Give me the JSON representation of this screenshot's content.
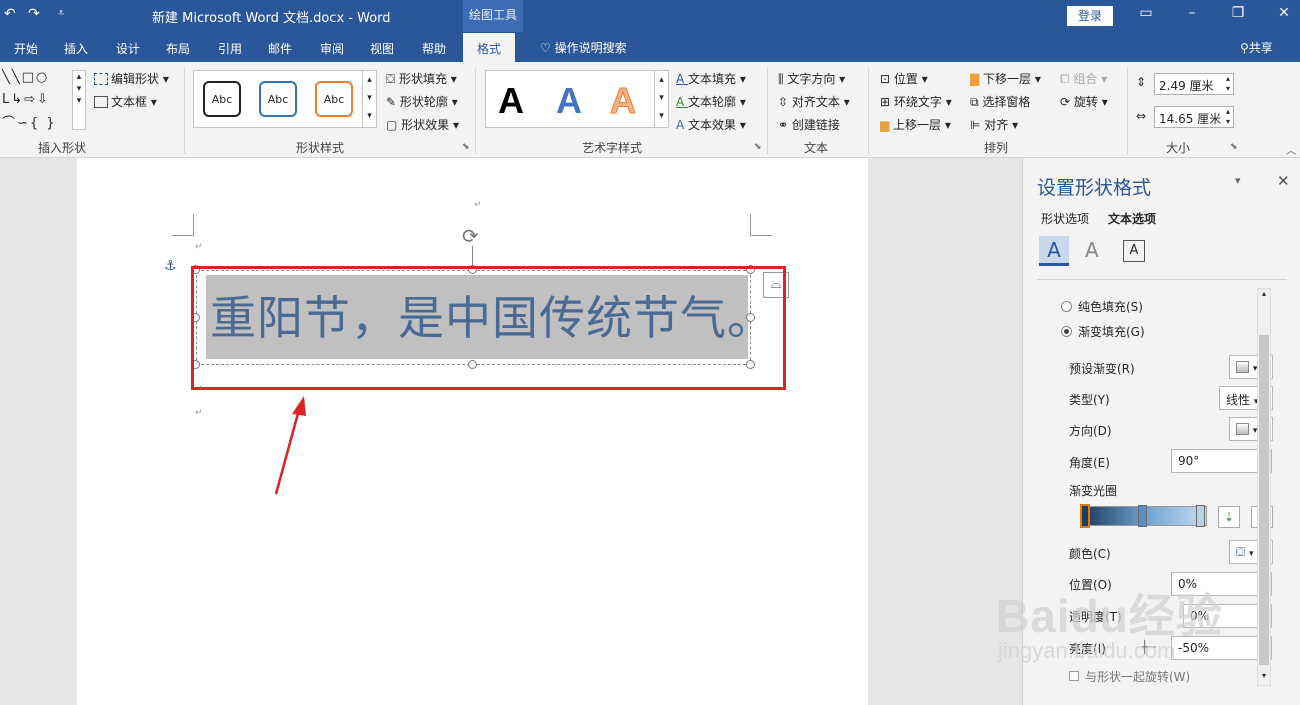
{
  "title_bar": {
    "document_title": "新建 Microsoft Word 文档.docx  -  Word",
    "context_tool": "绘图工具",
    "login": "登录"
  },
  "tabs": [
    {
      "label": "开始"
    },
    {
      "label": "插入"
    },
    {
      "label": "设计"
    },
    {
      "label": "布局"
    },
    {
      "label": "引用"
    },
    {
      "label": "邮件"
    },
    {
      "label": "审阅"
    },
    {
      "label": "视图"
    },
    {
      "label": "帮助"
    },
    {
      "label": "格式",
      "active": true
    }
  ],
  "tell_me": "操作说明搜索",
  "share": "共享",
  "ribbon": {
    "insert_shapes": {
      "label": "插入形状",
      "edit_shape": "编辑形状",
      "text_box": "文本框"
    },
    "shape_styles": {
      "label": "形状样式",
      "style_sample": "Abc",
      "fill": "形状填充",
      "outline": "形状轮廓",
      "effects": "形状效果"
    },
    "wordart_styles": {
      "label": "艺术字样式",
      "sample": "A",
      "text_fill": "文本填充",
      "text_outline": "文本轮廓",
      "text_effects": "文本效果"
    },
    "text": {
      "label": "文本",
      "direction": "文字方向",
      "align": "对齐文本",
      "link": "创建链接"
    },
    "arrange": {
      "label": "排列",
      "position": "位置",
      "wrap": "环绕文字",
      "bring_forward": "上移一层",
      "send_backward": "下移一层",
      "selection_pane": "选择窗格",
      "align": "对齐",
      "group": "组合",
      "rotate": "旋转"
    },
    "size": {
      "label": "大小",
      "height": "2.49 厘米",
      "width": "14.65 厘米"
    }
  },
  "document": {
    "text": "重阳节，是中国传统节气。"
  },
  "panel": {
    "title": "设置形状格式",
    "tab_shape": "形状选项",
    "tab_text": "文本选项",
    "solid_fill": "纯色填充(S)",
    "gradient_fill": "渐变填充(G)",
    "preset_gradient": "预设渐变(R)",
    "type_label": "类型(Y)",
    "type_value": "线性",
    "direction_label": "方向(D)",
    "angle_label": "角度(E)",
    "angle_value": "90°",
    "gradient_stops": "渐变光圈",
    "color_label": "颜色(C)",
    "position_label": "位置(O)",
    "position_value": "0%",
    "transparency_label": "透明度(T)",
    "transparency_value": "0%",
    "brightness_label": "亮度(I)",
    "brightness_value": "-50%",
    "rotate_with_shape": "与形状一起旋转(W)"
  },
  "watermark": {
    "brand": "Baidu经验",
    "url": "jingyan.baidu.com"
  },
  "colors": {
    "word_blue": "#2b579a",
    "annotation_red": "#dd2222",
    "text_blue": "#4a6a93"
  }
}
